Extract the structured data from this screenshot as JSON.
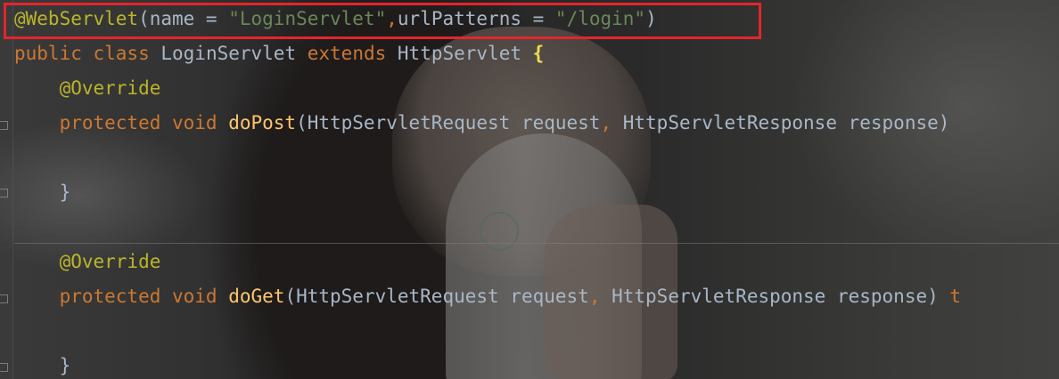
{
  "editor": {
    "lines": [
      {
        "id": "annotation-line",
        "tokens": [
          {
            "text": "@WebServlet",
            "kind": "ann"
          },
          {
            "text": "(name = ",
            "kind": "txt"
          },
          {
            "text": "\"LoginServlet\"",
            "kind": "str"
          },
          {
            "text": ",",
            "kind": "kw"
          },
          {
            "text": "urlPatterns = ",
            "kind": "txt"
          },
          {
            "text": "\"/login\"",
            "kind": "str"
          },
          {
            "text": ")",
            "kind": "txt"
          }
        ]
      },
      {
        "id": "class-declaration",
        "tokens": [
          {
            "text": "public class ",
            "kind": "kw"
          },
          {
            "text": "LoginServlet ",
            "kind": "txt"
          },
          {
            "text": "extends ",
            "kind": "kw"
          },
          {
            "text": "HttpServlet ",
            "kind": "txt"
          },
          {
            "text": "{",
            "kind": "brace"
          }
        ]
      },
      {
        "id": "override-annotation-1",
        "tokens": [
          {
            "text": "    @Override",
            "kind": "ann"
          }
        ]
      },
      {
        "id": "dopost-signature",
        "tokens": [
          {
            "text": "    protected void ",
            "kind": "kw"
          },
          {
            "text": "doPost",
            "kind": "fn"
          },
          {
            "text": "(HttpServletRequest request",
            "kind": "txt"
          },
          {
            "text": ", ",
            "kind": "kw"
          },
          {
            "text": "HttpServletResponse response) ",
            "kind": "txt"
          }
        ]
      },
      {
        "id": "dopost-body-empty",
        "tokens": []
      },
      {
        "id": "dopost-close",
        "tokens": [
          {
            "text": "    }",
            "kind": "txt"
          }
        ]
      },
      {
        "id": "blank-line",
        "tokens": []
      },
      {
        "id": "override-annotation-2",
        "tokens": [
          {
            "text": "    @Override",
            "kind": "ann"
          }
        ]
      },
      {
        "id": "doget-signature",
        "tokens": [
          {
            "text": "    protected void ",
            "kind": "kw"
          },
          {
            "text": "doGet",
            "kind": "fn"
          },
          {
            "text": "(HttpServletRequest request",
            "kind": "txt"
          },
          {
            "text": ", ",
            "kind": "kw"
          },
          {
            "text": "HttpServletResponse response) ",
            "kind": "txt"
          },
          {
            "text": "t",
            "kind": "kw"
          }
        ]
      },
      {
        "id": "doget-body-empty",
        "tokens": []
      },
      {
        "id": "doget-close",
        "tokens": [
          {
            "text": "    }",
            "kind": "txt"
          }
        ]
      }
    ]
  },
  "colors": {
    "keyword": "#cc7832",
    "annotation": "#bbb529",
    "string": "#6a8759",
    "method": "#ffc66d",
    "text": "#a9b7c6",
    "highlight_box": "#e4252b"
  }
}
